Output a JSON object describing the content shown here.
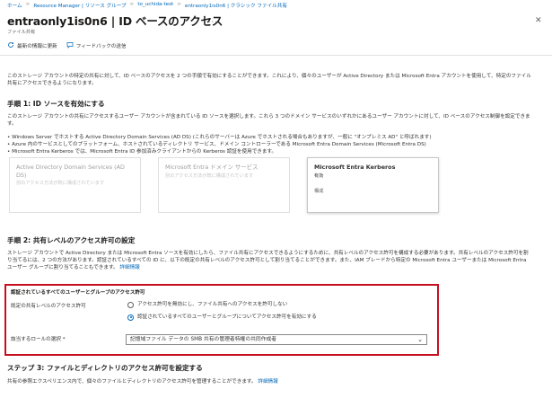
{
  "breadcrumb": {
    "items": [
      "ホーム",
      "Resource Manager | リソース グループ",
      "to_uchida-test",
      "entraonly1is0n6 | クラシック ファイル共有"
    ],
    "separator": ">"
  },
  "header": {
    "title": "entraonly1is0n6 | ID ベースのアクセス",
    "subtitle": "ファイル共有",
    "more": "···",
    "close": "✕"
  },
  "toolbar": {
    "refresh_icon": "refresh-icon",
    "refresh_label": "最新の情報に更新",
    "feedback_icon": "feedback-icon",
    "feedback_label": "フィードバックの送信"
  },
  "intro": {
    "text": "このストレージ アカウントの特定の共有に対して、ID ベースのアクセスを 2 つの手順で有効にすることができます。これにより、個々のユーザーが Active Directory または Microsoft Entra アカウントを使用して、特定のファイル共有にアクセスできるようになります。"
  },
  "step1": {
    "heading": "手順 1: ID ソースを有効にする",
    "desc": "このストレージ アカウントの共有にアクセスするユーザー アカウントが含まれている ID ソースを選択します。これら 3 つのドメイン サービスのいずれかにあるユーザー アカウントに対して、ID ベースのアクセス制御を設定できます。",
    "bullets": [
      "Windows Server でホストする Active Directory Domain Services (AD DS) (これらのサーバーは Azure でホストされる場合もありますが、一般に \"オンプレミス AD\" と呼ばれます)",
      "Azure 内のサービスとしてのプラットフォーム、ホストされているディレクトリ サービス、ドメイン コントローラーである Microsoft Entra Domain Services (Microsoft Entra DS)",
      "Microsoft Entra Kerberos では、Microsoft Entra ID 参加済みクライアントからの Kerberos 認証を使用できます。"
    ],
    "cards": [
      {
        "title": "Active Directory Domain Services (AD DS)",
        "sub": "別のアクセス方法が既に構成されています"
      },
      {
        "title": "Microsoft Entra ドメイン サービス",
        "sub": "別のアクセス方法が既に構成されています"
      },
      {
        "title": "Microsoft Entra Kerberos",
        "sub": "有効",
        "link": "構成"
      }
    ]
  },
  "step2": {
    "heading": "手順 2: 共有レベルのアクセス許可の設定",
    "desc": "ストレージ アカウントで Active Directory または Microsoft Entra ソースを有効にしたら、ファイル共有にアクセスできるようにするために、共有レベルのアクセス許可を構成する必要があります。共有レベルのアクセス許可を割り当てるには、2 つの方法があります。認証されているすべての ID に、以下の既定の共有レベルのアクセス許可として割り当てることができます。また、IAM ブレードから特定の Microsoft Entra ユーザーまたは Microsoft Entra ユーザー グループに割り当てることもできます。",
    "desc_link": "詳細情報",
    "box_heading": "認証されているすべてのユーザーとグループのアクセス許可",
    "default_label": "既定の共有レベルのアクセス許可",
    "radio1": "アクセス許可を無効にし、ファイル共有へのアクセスを許可しない",
    "radio2": "認証されているすべてのユーザーとグループについてアクセス許可を有効にする",
    "role_label": "該当するロールの選択 *",
    "role_value": "記憶域ファイル データの SMB 共有の管理者特権の共同作成者",
    "chevron_icon": "chevron-down-icon"
  },
  "step3": {
    "heading": "ステップ 3: ファイルとディレクトリのアクセス許可を設定する",
    "desc": "共有の参照エクスペリエンス内で、個々のファイルとディレクトリのアクセス許可を管理することができます。",
    "link": "詳細情報"
  },
  "colors": {
    "accent": "#0067b8",
    "highlight_border": "#c50f1f",
    "text": "#323130"
  }
}
